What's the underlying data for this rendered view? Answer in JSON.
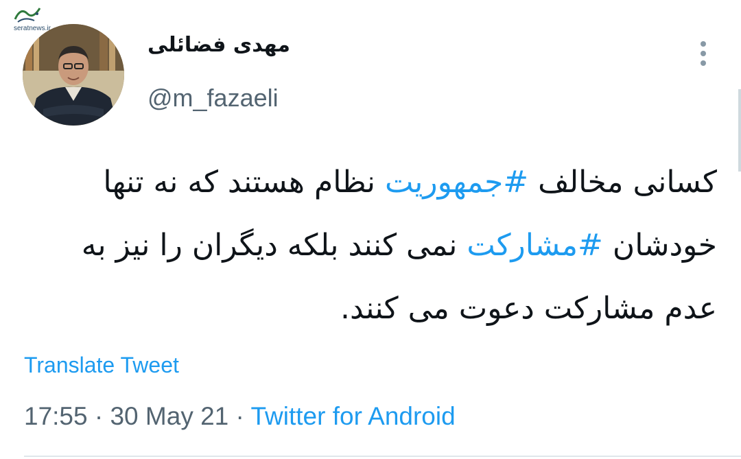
{
  "watermark": {
    "site": "seratnews.ir"
  },
  "user": {
    "display_name": "مهدی فضائلی",
    "handle": "@m_fazaeli",
    "avatar_icon": "profile-photo"
  },
  "menu": {
    "icon": "more-vertical-icon"
  },
  "tweet": {
    "segments": [
      {
        "text": "کسانی مخالف ",
        "hashtag": false
      },
      {
        "text": "#جمهوریت",
        "hashtag": true
      },
      {
        "text": " نظام هستند که نه تنها خودشان ",
        "hashtag": false
      },
      {
        "text": "#مشارکت",
        "hashtag": true
      },
      {
        "text": " نمی کنند بلکه دیگران را نیز به عدم مشارکت دعوت می کنند.",
        "hashtag": false
      }
    ]
  },
  "translate": {
    "label": "Translate Tweet"
  },
  "meta": {
    "time": "17:55",
    "separator": "·",
    "date": "30 May 21",
    "source": "Twitter for Android"
  },
  "colors": {
    "link": "#1d9bf0",
    "text": "#0f1419",
    "muted": "#536471"
  }
}
